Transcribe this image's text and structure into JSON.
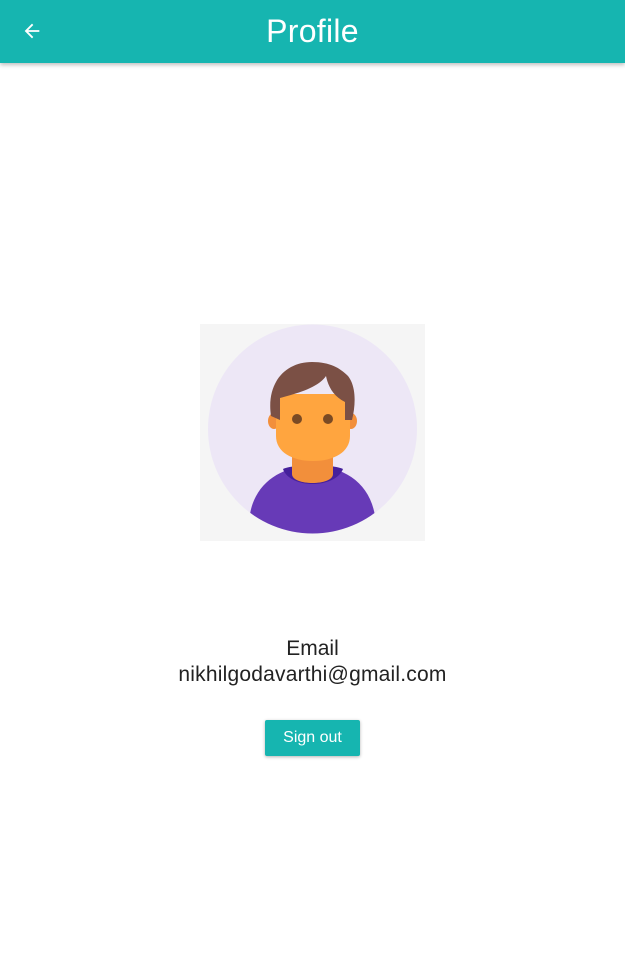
{
  "colors": {
    "app_bar": "#16B5B0",
    "button": "#16B5B0",
    "avatar_background": "#EDE7F6",
    "avatar_frame": "#F5F5F5",
    "skin": "#FFA53F",
    "hair": "#7B5045",
    "shirt": "#673AB7"
  },
  "header": {
    "back_icon": "arrow-left-icon",
    "title": "Profile"
  },
  "profile": {
    "avatar_icon": "user-avatar-icon",
    "email_label": "Email",
    "email_value": "nikhilgodavarthi@gmail.com"
  },
  "actions": {
    "sign_out_label": "Sign out"
  }
}
